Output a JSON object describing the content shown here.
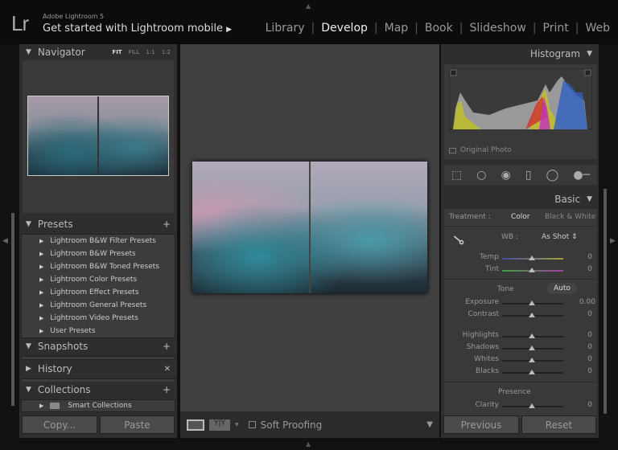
{
  "app": {
    "logo": "Lr",
    "subtitle": "Adobe Lightroom 5",
    "mobile": "Get started with Lightroom mobile"
  },
  "modules": [
    {
      "label": "Library"
    },
    {
      "label": "Develop",
      "active": true
    },
    {
      "label": "Map"
    },
    {
      "label": "Book"
    },
    {
      "label": "Slideshow"
    },
    {
      "label": "Print"
    },
    {
      "label": "Web"
    }
  ],
  "navigator": {
    "title": "Navigator",
    "zooms": [
      "FIT",
      "FILL",
      "1:1",
      "1:2"
    ]
  },
  "presets": {
    "title": "Presets",
    "items": [
      "Lightroom B&W Filter Presets",
      "Lightroom B&W Presets",
      "Lightroom B&W Toned Presets",
      "Lightroom Color Presets",
      "Lightroom Effect Presets",
      "Lightroom General Presets",
      "Lightroom Video Presets",
      "User Presets"
    ]
  },
  "snapshots": {
    "title": "Snapshots"
  },
  "history": {
    "title": "History"
  },
  "collections": {
    "title": "Collections",
    "items": [
      "Smart Collections"
    ]
  },
  "left_buttons": {
    "copy": "Copy...",
    "paste": "Paste"
  },
  "toolbar": {
    "soft_proofing": "Soft Proofing"
  },
  "histogram": {
    "title": "Histogram",
    "original": "Original Photo"
  },
  "basic": {
    "title": "Basic",
    "treatment_label": "Treatment :",
    "color": "Color",
    "bw": "Black & White",
    "wb_label": "WB :",
    "wb_value": "As Shot",
    "tone": "Tone",
    "auto": "Auto",
    "presence": "Presence",
    "sliders": [
      {
        "label": "Temp",
        "value": "0",
        "pos": 0.5
      },
      {
        "label": "Tint",
        "value": "0",
        "pos": 0.5
      },
      {
        "label": "Exposure",
        "value": "0.00",
        "pos": 0.5
      },
      {
        "label": "Contrast",
        "value": "0",
        "pos": 0.5
      },
      {
        "label": "Highlights",
        "value": "0",
        "pos": 0.5
      },
      {
        "label": "Shadows",
        "value": "0",
        "pos": 0.5
      },
      {
        "label": "Whites",
        "value": "0",
        "pos": 0.5
      },
      {
        "label": "Blacks",
        "value": "0",
        "pos": 0.5
      },
      {
        "label": "Clarity",
        "value": "0",
        "pos": 0.5
      }
    ]
  },
  "right_buttons": {
    "previous": "Previous",
    "reset": "Reset"
  }
}
